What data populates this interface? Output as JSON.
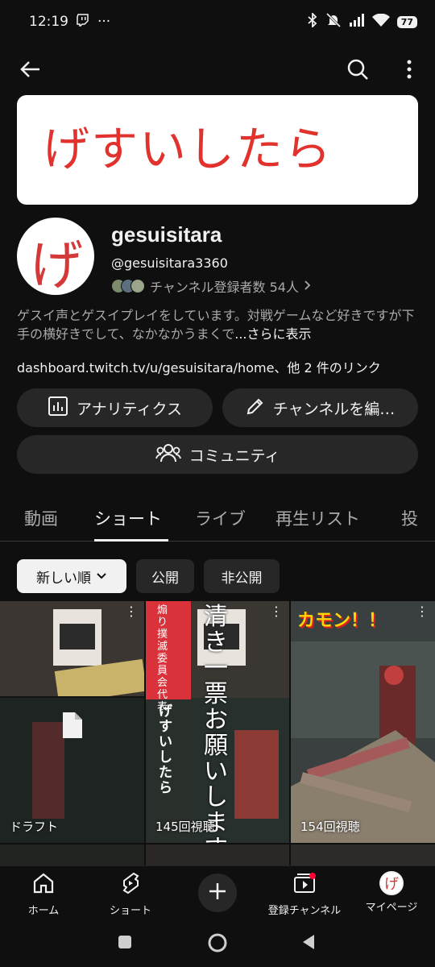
{
  "status": {
    "time": "12:19",
    "battery": "77",
    "dots": "···"
  },
  "banner": {
    "text": "げすいしたら"
  },
  "avatar": {
    "text": "げ"
  },
  "channel": {
    "name": "gesuisitara",
    "handle": "@gesuisitara3360",
    "subscribers": "チャンネル登録者数 54人",
    "description": "ゲスイ声とゲスイプレイをしています。対戦ゲームなど好きですが下手の横好きでして、なかなかうまくで",
    "more": "...さらに表示",
    "links": "dashboard.twitch.tv/u/gesuisitara/home、他 2 件のリンク"
  },
  "buttons": {
    "analytics": "アナリティクス",
    "edit": "チャンネルを編…",
    "community": "コミュニティ"
  },
  "tabs": [
    "動画",
    "ショート",
    "ライブ",
    "再生リスト",
    "投"
  ],
  "filters": {
    "sort": "新しい順",
    "public": "公開",
    "private": "非公開"
  },
  "shorts": [
    {
      "label": "ドラフト"
    },
    {
      "label": "145回視聴",
      "vertical_text": "清き一票お願いします",
      "badge_text": "煽り撲滅委員会代表",
      "name_text": "げすいしたら"
    },
    {
      "label": "154回視聴",
      "title_text": "カモン！！"
    }
  ],
  "nav": {
    "home": "ホーム",
    "shorts": "ショート",
    "subscriptions": "登録チャンネル",
    "mypage": "マイページ"
  },
  "colors": {
    "background": "#0f0f0f",
    "chip": "#272727",
    "accent_red": "#e1322d"
  }
}
